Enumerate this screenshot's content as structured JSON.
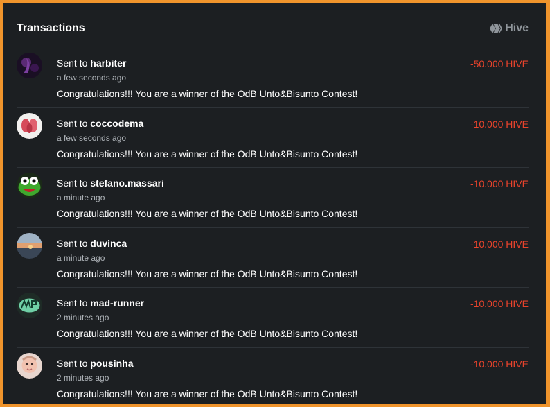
{
  "header": {
    "title": "Transactions",
    "chain_label": "Hive",
    "chain_icon": "hive-logo-icon"
  },
  "colors": {
    "frame": "#f0942c",
    "background": "#1c1f22",
    "amount": "#e8432c",
    "muted": "#aeb3b8"
  },
  "transactions": [
    {
      "prefix": "Sent to",
      "user": "harbiter",
      "time": "a few seconds ago",
      "memo": "Congratulations!!! You are a winner of the OdB Unto&Bisunto Contest!",
      "amount": "-50.000 HIVE"
    },
    {
      "prefix": "Sent to",
      "user": "coccodema",
      "time": "a few seconds ago",
      "memo": "Congratulations!!! You are a winner of the OdB Unto&Bisunto Contest!",
      "amount": "-10.000 HIVE"
    },
    {
      "prefix": "Sent to",
      "user": "stefano.massari",
      "time": "a minute ago",
      "memo": "Congratulations!!! You are a winner of the OdB Unto&Bisunto Contest!",
      "amount": "-10.000 HIVE"
    },
    {
      "prefix": "Sent to",
      "user": "duvinca",
      "time": "a minute ago",
      "memo": "Congratulations!!! You are a winner of the OdB Unto&Bisunto Contest!",
      "amount": "-10.000 HIVE"
    },
    {
      "prefix": "Sent to",
      "user": "mad-runner",
      "time": "2 minutes ago",
      "memo": "Congratulations!!! You are a winner of the OdB Unto&Bisunto Contest!",
      "amount": "-10.000 HIVE"
    },
    {
      "prefix": "Sent to",
      "user": "pousinha",
      "time": "2 minutes ago",
      "memo": "Congratulations!!! You are a winner of the OdB Unto&Bisunto Contest!",
      "amount": "-10.000 HIVE"
    }
  ]
}
